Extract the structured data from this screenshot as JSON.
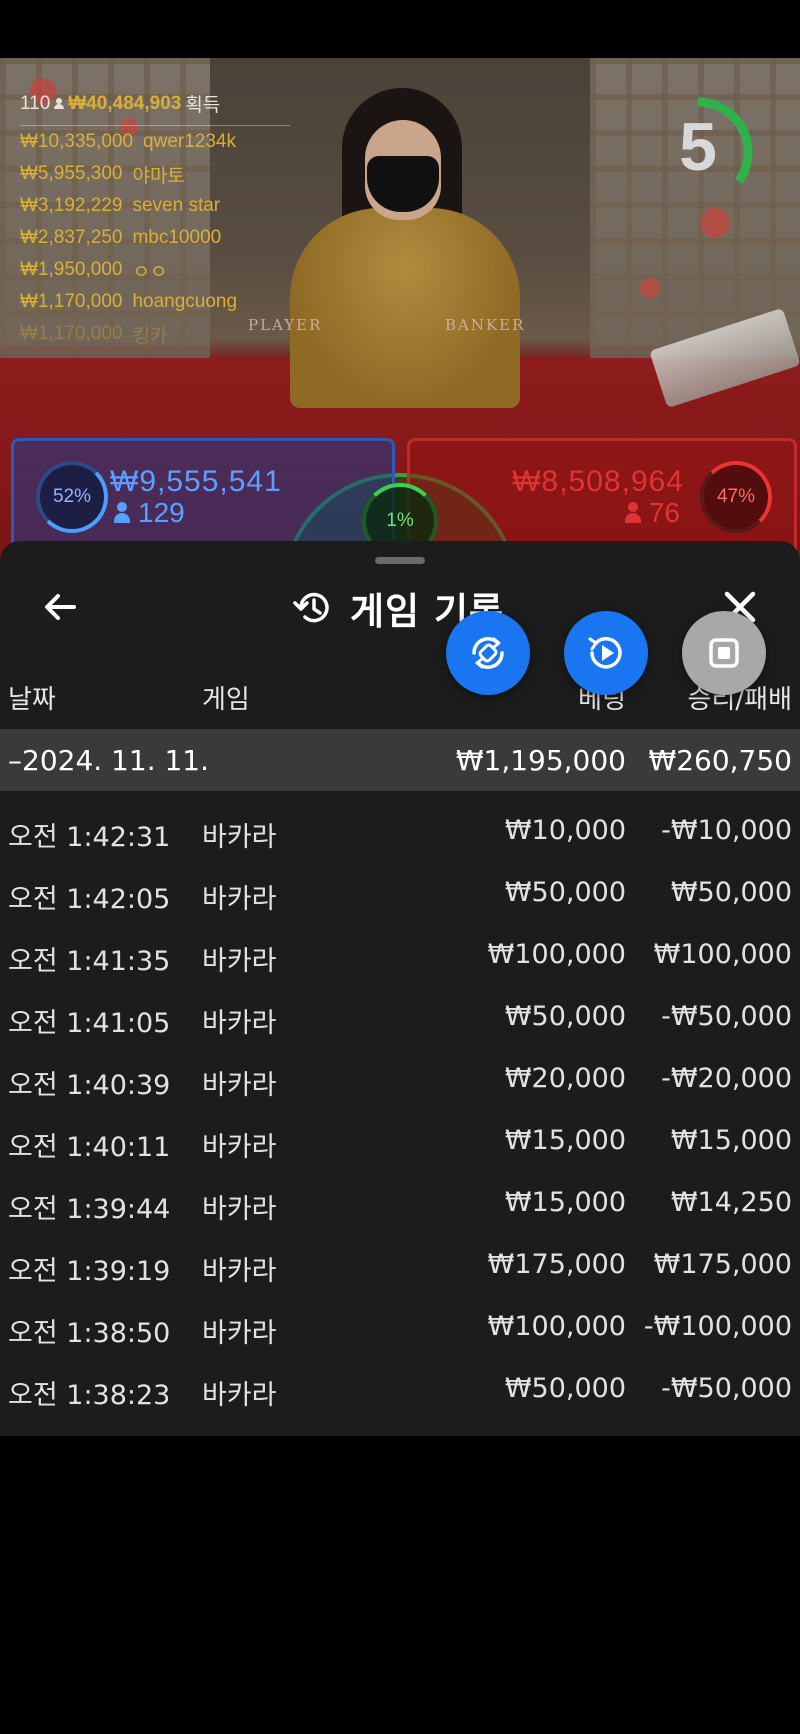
{
  "leaderboard": {
    "count": "110",
    "total": "₩40,484,903",
    "suffix": "획득",
    "rows": [
      {
        "amount": "₩10,335,000",
        "name": "qwer1234k"
      },
      {
        "amount": "₩5,955,300",
        "name": "야마토"
      },
      {
        "amount": "₩3,192,229",
        "name": "seven star"
      },
      {
        "amount": "₩2,837,250",
        "name": "mbc10000"
      },
      {
        "amount": "₩1,950,000",
        "name": "ㅇㅇ"
      },
      {
        "amount": "₩1,170,000",
        "name": "hoangcuong"
      },
      {
        "amount": "₩1,170,000",
        "name": "킹카"
      }
    ]
  },
  "timer": {
    "value": "5",
    "fraction": 0.35
  },
  "table_labels": {
    "player": "PLAYER",
    "banker": "BANKER"
  },
  "bets": {
    "player": {
      "percent": "52%",
      "amount": "₩9,555,541",
      "players": "129"
    },
    "banker": {
      "percent": "47%",
      "amount": "₩8,508,964",
      "players": "76"
    },
    "tie": {
      "percent": "1%"
    }
  },
  "sheet": {
    "title": "게임 기록",
    "columns": {
      "date": "날짜",
      "game": "게임",
      "bet": "베팅",
      "winloss": "승리/패배"
    },
    "date_group": {
      "date": "–2024. 11. 11.",
      "bet_total": "₩1,195,000",
      "win_total": "₩260,750"
    },
    "rows": [
      {
        "time": "오전 1:42:31",
        "game": "바카라",
        "bet": "₩10,000",
        "result": "-₩10,000"
      },
      {
        "time": "오전 1:42:05",
        "game": "바카라",
        "bet": "₩50,000",
        "result": "₩50,000"
      },
      {
        "time": "오전 1:41:35",
        "game": "바카라",
        "bet": "₩100,000",
        "result": "₩100,000"
      },
      {
        "time": "오전 1:41:05",
        "game": "바카라",
        "bet": "₩50,000",
        "result": "-₩50,000"
      },
      {
        "time": "오전 1:40:39",
        "game": "바카라",
        "bet": "₩20,000",
        "result": "-₩20,000"
      },
      {
        "time": "오전 1:40:11",
        "game": "바카라",
        "bet": "₩15,000",
        "result": "₩15,000"
      },
      {
        "time": "오전 1:39:44",
        "game": "바카라",
        "bet": "₩15,000",
        "result": "₩14,250"
      },
      {
        "time": "오전 1:39:19",
        "game": "바카라",
        "bet": "₩175,000",
        "result": "₩175,000"
      },
      {
        "time": "오전 1:38:50",
        "game": "바카라",
        "bet": "₩100,000",
        "result": "-₩100,000"
      },
      {
        "time": "오전 1:38:23",
        "game": "바카라",
        "bet": "₩50,000",
        "result": "-₩50,000"
      }
    ]
  },
  "icons": {
    "back": "arrow-left-icon",
    "history": "history-icon",
    "close": "close-icon",
    "rotate": "screen-rotate-icon",
    "replay": "replay-icon",
    "stop": "stop-icon"
  },
  "colors": {
    "gold": "#d9b035",
    "player_blue": "#5aa0ff",
    "banker_red": "#e03434",
    "tie_green": "#3bd24a",
    "fab_blue": "#1976f0",
    "sheet_bg": "#1c1c1c",
    "date_bar_bg": "#3a3a3a"
  }
}
